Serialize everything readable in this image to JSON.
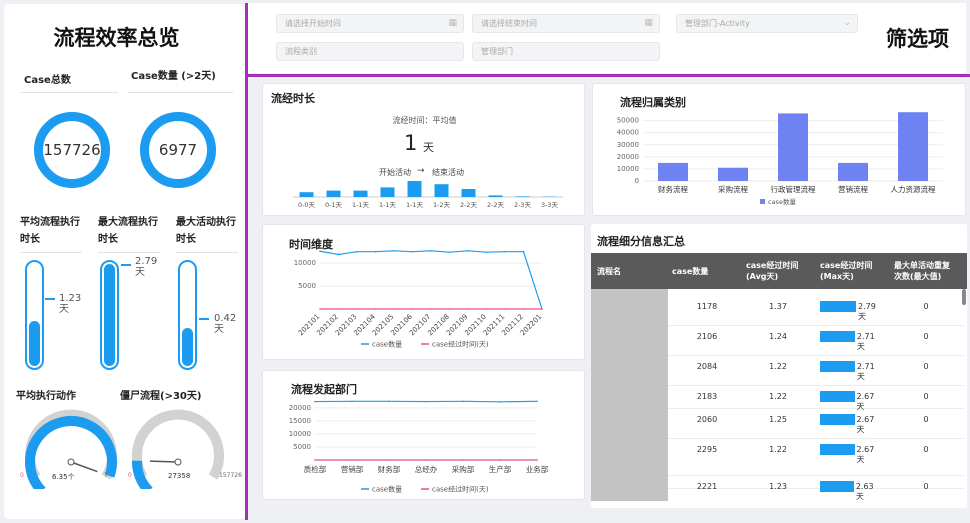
{
  "left": {
    "title": "流程效率总览",
    "case_total_label": "Case总数",
    "case_total_value": "157726",
    "case_over2_label": "Case数量 (>2天)",
    "case_over2_value": "6977",
    "tubes": [
      {
        "label": "平均流程执行时长",
        "value": "1.23\n天",
        "level": 0.44
      },
      {
        "label": "最大流程执行时长",
        "value": "2.79\n天",
        "level": 1.0
      },
      {
        "label": "最大活动执行时长",
        "value": "0.42\n天",
        "level": 0.37
      }
    ],
    "gauges": [
      {
        "label": "平均执行动作",
        "min": "0",
        "max": "7",
        "value": "6.35个",
        "level": 0.907
      },
      {
        "label": "僵尸流程(>30天)",
        "min": "0",
        "max": "157726",
        "value": "27358",
        "level": 0.173
      }
    ]
  },
  "filters": {
    "title": "筛选项",
    "start": {
      "placeholder": "请选择开始时间",
      "icon": "calendar-icon"
    },
    "end": {
      "placeholder": "请选择结束时间",
      "icon": "calendar-icon"
    },
    "dept_activity": {
      "placeholder": "管理部门-Activity",
      "icon": "chevron-down-icon"
    },
    "flow_type": {
      "placeholder": "流程类别"
    },
    "dept": {
      "placeholder": "管理部门"
    }
  },
  "duration": {
    "title": "流经时长",
    "subtitle": "流经时间：平均值",
    "value": "1",
    "unit": "天",
    "from": "开始活动",
    "arrow": "→",
    "to": "结束活动"
  },
  "chart_data": [
    {
      "type": "bar",
      "title": "",
      "categories": [
        "0-0天",
        "0-1天",
        "1-1天",
        "1-1天",
        "1-1天",
        "1-2天",
        "2-2天",
        "2-2天",
        "2-3天",
        "3-3天"
      ],
      "values": [
        3,
        4,
        4,
        6,
        10,
        8,
        5,
        1,
        0.4,
        0.2
      ]
    },
    {
      "type": "line",
      "title": "时间维度",
      "x": [
        "202101",
        "202102",
        "202103",
        "202104",
        "202105",
        "202106",
        "202107",
        "202108",
        "202109",
        "202110",
        "202111",
        "202112",
        "202201"
      ],
      "yticks": [
        5000,
        10000
      ],
      "ylim": [
        0,
        12000
      ],
      "series": [
        {
          "name": "case数量",
          "color": "#1c9cf0",
          "values": [
            12600,
            11900,
            12500,
            12500,
            12700,
            12500,
            12700,
            12400,
            12700,
            12400,
            12500,
            12500,
            0
          ]
        },
        {
          "name": "case经过时间(天)",
          "color": "#e8507a",
          "values": [
            1.2,
            1.2,
            1.2,
            1.2,
            1.2,
            1.2,
            1.2,
            1.2,
            1.2,
            1.2,
            1.2,
            1.2,
            1.2
          ]
        }
      ]
    },
    {
      "type": "line",
      "title": "流程发起部门",
      "x": [
        "质检部",
        "营销部",
        "财务部",
        "总经办",
        "采购部",
        "生产部",
        "业务部"
      ],
      "yticks": [
        5000,
        10000,
        15000,
        20000
      ],
      "ylim": [
        0,
        23000
      ],
      "series": [
        {
          "name": "case数量",
          "color": "#1c9cf0",
          "values": [
            22400,
            22500,
            22500,
            22400,
            22500,
            22300,
            22500
          ]
        },
        {
          "name": "case经过时间(天)",
          "color": "#e8507a",
          "values": [
            1.2,
            1.2,
            1.2,
            1.2,
            1.2,
            1.2,
            1.2
          ]
        }
      ]
    },
    {
      "type": "bar",
      "title": "流程归属类别",
      "categories": [
        "财务流程",
        "采购流程",
        "行政管理流程",
        "营销流程",
        "人力资源流程"
      ],
      "yticks": [
        0,
        10000,
        20000,
        30000,
        40000,
        50000
      ],
      "ylim": [
        0,
        58000
      ],
      "series": [
        {
          "name": "case数量",
          "color": "#6e82f2",
          "values": [
            15000,
            11000,
            56000,
            15000,
            57000
          ]
        }
      ]
    }
  ],
  "table": {
    "title": "流程细分信息汇总",
    "headers": [
      "流程名",
      "case数量",
      "case经过时间\n(Avg天)",
      "case经过时间\n(Max天)",
      "最大单活动重复\n次数(最大值)"
    ],
    "rows": [
      {
        "count": "1178",
        "avg": "1.37",
        "max": "2.79天",
        "max_level": 1.0,
        "rep": "0"
      },
      {
        "count": "2106",
        "avg": "1.24",
        "max": "2.71天",
        "max_level": 0.97,
        "rep": "0"
      },
      {
        "count": "2084",
        "avg": "1.22",
        "max": "2.71天",
        "max_level": 0.97,
        "rep": "0"
      },
      {
        "count": "2183",
        "avg": "1.22",
        "max": "2.67天",
        "max_level": 0.96,
        "rep": "0"
      },
      {
        "count": "2060",
        "avg": "1.25",
        "max": "2.67天",
        "max_level": 0.96,
        "rep": "0"
      },
      {
        "count": "2295",
        "avg": "1.22",
        "max": "2.67天",
        "max_level": 0.96,
        "rep": "0"
      },
      {
        "count": "2221",
        "avg": "1.23",
        "max": "2.63天",
        "max_level": 0.94,
        "rep": "0"
      }
    ]
  }
}
